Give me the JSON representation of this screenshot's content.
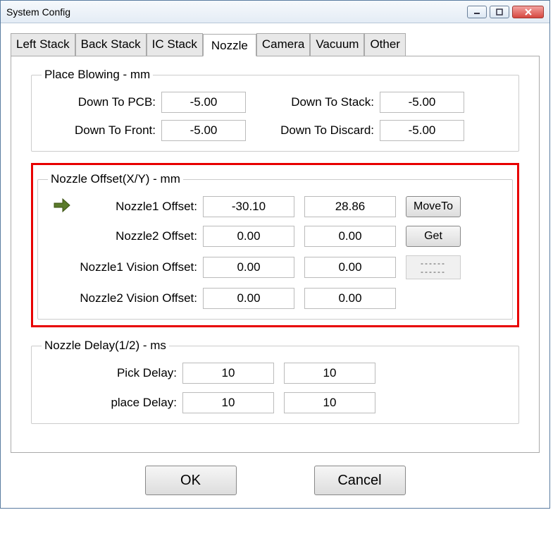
{
  "window": {
    "title": "System Config"
  },
  "tabs": [
    "Left Stack",
    "Back Stack",
    "IC Stack",
    "Nozzle",
    "Camera",
    "Vacuum",
    "Other"
  ],
  "activeTab": "Nozzle",
  "placeBlowing": {
    "legend": "Place Blowing - mm",
    "downToPCB": {
      "label": "Down To PCB:",
      "value": "-5.00"
    },
    "downToStack": {
      "label": "Down To Stack:",
      "value": "-5.00"
    },
    "downToFront": {
      "label": "Down To Front:",
      "value": "-5.00"
    },
    "downToDiscard": {
      "label": "Down To Discard:",
      "value": "-5.00"
    }
  },
  "nozzleOffset": {
    "legend": "Nozzle Offset(X/Y) - mm",
    "nozzle1": {
      "label": "Nozzle1 Offset:",
      "x": "-30.10",
      "y": "28.86"
    },
    "nozzle2": {
      "label": "Nozzle2 Offset:",
      "x": "0.00",
      "y": "0.00"
    },
    "nozzle1Vision": {
      "label": "Nozzle1 Vision Offset:",
      "x": "0.00",
      "y": "0.00"
    },
    "nozzle2Vision": {
      "label": "Nozzle2 Vision Offset:",
      "x": "0.00",
      "y": "0.00"
    },
    "moveTo": "MoveTo",
    "get": "Get",
    "dash": "------\n------"
  },
  "nozzleDelay": {
    "legend": "Nozzle Delay(1/2) - ms",
    "pick": {
      "label": "Pick Delay:",
      "v1": "10",
      "v2": "10"
    },
    "place": {
      "label": "place Delay:",
      "v1": "10",
      "v2": "10"
    }
  },
  "buttons": {
    "ok": "OK",
    "cancel": "Cancel"
  }
}
